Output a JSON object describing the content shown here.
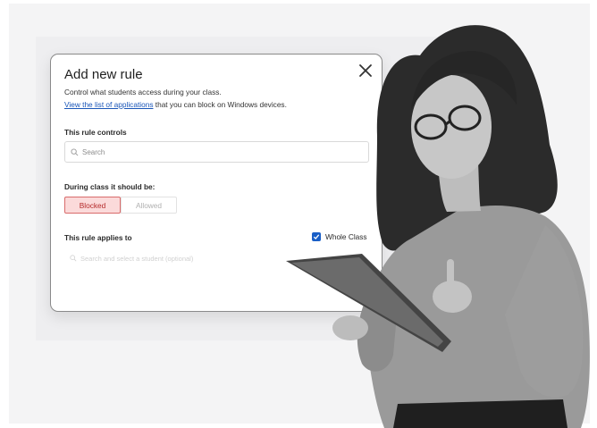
{
  "dialog": {
    "title": "Add new rule",
    "subtitle": "Control what students access during your class.",
    "link_text": "View the list of applications",
    "link_suffix": " that you can block on Windows devices.",
    "rule_controls_label": "This rule controls",
    "search_placeholder": "Search",
    "during_class_label": "During class it should be:",
    "options": [
      "Blocked",
      "Allowed"
    ],
    "selected_option": "Blocked",
    "applies_to_label": "This rule applies to",
    "whole_class_label": "Whole Class",
    "whole_class_checked": true,
    "student_placeholder": "Search and select a student (optional)"
  },
  "icons": {
    "close": "close-icon",
    "search": "search-icon",
    "checkbox": "checkmark-icon"
  },
  "colors": {
    "accent": "#1a5fc7",
    "link": "#1a56b8",
    "blocked_bg": "#fbdada",
    "blocked_border": "#d86b6b",
    "blocked_text": "#b52a2a"
  }
}
